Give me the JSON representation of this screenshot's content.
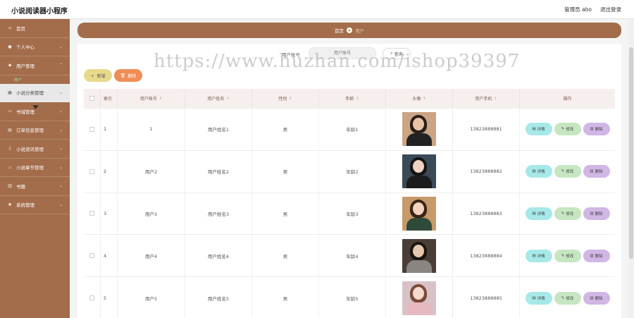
{
  "app": {
    "title": "小说阅读器小程序"
  },
  "topbar": {
    "admin_label": "管理员 abo",
    "logout_label": "退出登录"
  },
  "sidebar": {
    "items": [
      {
        "label": "首页",
        "icon": "home-icon"
      },
      {
        "label": "个人中心",
        "icon": "user-icon"
      },
      {
        "label": "用户管理",
        "icon": "users-icon"
      },
      {
        "label": "小说分类管理",
        "icon": "category-icon"
      },
      {
        "label": "书城管理",
        "icon": "store-icon"
      },
      {
        "label": "订单信息管理",
        "icon": "order-icon"
      },
      {
        "label": "小说资讯管理",
        "icon": "news-icon"
      },
      {
        "label": "小说章节管理",
        "icon": "chapter-icon"
      },
      {
        "label": "书籍",
        "icon": "book-icon"
      },
      {
        "label": "系统管理",
        "icon": "settings-icon"
      }
    ],
    "sub_label": "用户"
  },
  "breadcrumb": {
    "home": "首页",
    "current": "用户"
  },
  "search": {
    "label": "用户账号",
    "placeholder": "用户账号",
    "button": "查询"
  },
  "toolbar": {
    "add_label": "新增",
    "delete_label": "删除"
  },
  "table": {
    "headers": [
      "索引",
      "用户账号",
      "用户姓名",
      "性别",
      "年龄",
      "头像",
      "用户手机",
      "操作"
    ],
    "rows": [
      {
        "index": "1",
        "account": "1",
        "name": "用户姓名1",
        "gender": "男",
        "age": "年龄1",
        "phone": "13823888881"
      },
      {
        "index": "2",
        "account": "用户2",
        "name": "用户姓名2",
        "gender": "男",
        "age": "年龄2",
        "phone": "13823888882"
      },
      {
        "index": "3",
        "account": "用户3",
        "name": "用户姓名3",
        "gender": "男",
        "age": "年龄3",
        "phone": "13823888883"
      },
      {
        "index": "4",
        "account": "用户4",
        "name": "用户姓名4",
        "gender": "男",
        "age": "年龄4",
        "phone": "13823888884"
      },
      {
        "index": "5",
        "account": "用户5",
        "name": "用户姓名5",
        "gender": "男",
        "age": "年龄5",
        "phone": "13823888885"
      }
    ],
    "actions": {
      "detail": "详情",
      "edit": "修改",
      "remove": "删除"
    }
  },
  "watermark": "https://www.huzhan.com/ishop39397",
  "colors": {
    "sidebar": "#a36d4b",
    "detail_btn": "#a7e8e9",
    "edit_btn": "#c6e6c2",
    "remove_btn": "#d1b6e6",
    "add_btn": "#e7d98a",
    "delete_btn": "#f08d55"
  }
}
